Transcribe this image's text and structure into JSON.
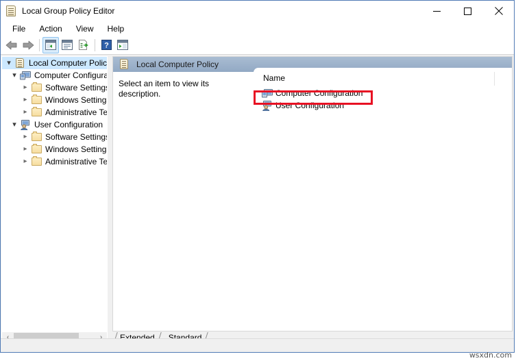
{
  "window": {
    "title": "Local Group Policy Editor",
    "title_icon": "policy-scroll-icon",
    "controls": {
      "minimize": "minimize-icon",
      "maximize": "maximize-icon",
      "close": "close-icon"
    }
  },
  "menubar": {
    "items": [
      {
        "label": "File"
      },
      {
        "label": "Action"
      },
      {
        "label": "View"
      },
      {
        "label": "Help"
      }
    ]
  },
  "toolbar": {
    "buttons": [
      {
        "name": "back-icon",
        "label": "Back"
      },
      {
        "name": "forward-icon",
        "label": "Forward"
      },
      {
        "name": "show-hide-tree-icon",
        "label": "Show/Hide Console Tree",
        "active": true
      },
      {
        "name": "properties-icon",
        "label": "Properties"
      },
      {
        "name": "export-list-icon",
        "label": "Export List"
      },
      {
        "name": "help-icon",
        "label": "Help"
      },
      {
        "name": "show-action-pane-icon",
        "label": "Show/Hide Action Pane"
      }
    ]
  },
  "tree": {
    "items": [
      {
        "label": "Local Computer Policy",
        "icon": "policy-scroll-icon",
        "indent": 0,
        "expander": "expanded",
        "selected": true
      },
      {
        "label": "Computer Configuration",
        "icon": "computer-icon",
        "indent": 1,
        "expander": "expanded",
        "selected": false
      },
      {
        "label": "Software Settings",
        "icon": "folder-icon",
        "indent": 2,
        "expander": "collapsed",
        "selected": false
      },
      {
        "label": "Windows Settings",
        "icon": "folder-icon",
        "indent": 2,
        "expander": "collapsed",
        "selected": false
      },
      {
        "label": "Administrative Templates",
        "icon": "folder-icon",
        "indent": 2,
        "expander": "collapsed",
        "selected": false
      },
      {
        "label": "User Configuration",
        "icon": "user-icon",
        "indent": 1,
        "expander": "expanded",
        "selected": false
      },
      {
        "label": "Software Settings",
        "icon": "folder-icon",
        "indent": 2,
        "expander": "collapsed",
        "selected": false
      },
      {
        "label": "Windows Settings",
        "icon": "folder-icon",
        "indent": 2,
        "expander": "collapsed",
        "selected": false
      },
      {
        "label": "Administrative Templates",
        "icon": "folder-icon",
        "indent": 2,
        "expander": "collapsed",
        "selected": false
      }
    ],
    "scrollbar": {
      "left_arrow": "‹",
      "right_arrow": "›"
    }
  },
  "right_pane": {
    "header_title": "Local Computer Policy",
    "header_icon": "policy-scroll-icon",
    "description": "Select an item to view its description.",
    "column_header": "Name",
    "items": [
      {
        "label": "Computer Configuration",
        "icon": "computer-icon",
        "highlighted": true
      },
      {
        "label": "User Configuration",
        "icon": "user-icon",
        "highlighted": false
      }
    ]
  },
  "tabs": [
    {
      "label": "Extended",
      "active": true
    },
    {
      "label": "Standard",
      "active": false
    }
  ],
  "watermark": "wsxdn.com",
  "colors": {
    "highlight_box": "#e81123",
    "pane_header_top": "#a9bcd2",
    "pane_header_bottom": "#92a9c4",
    "tree_selection": "#cce8ff",
    "window_border": "#4f7ab5",
    "toolbar_active": "#d9ecfb"
  }
}
